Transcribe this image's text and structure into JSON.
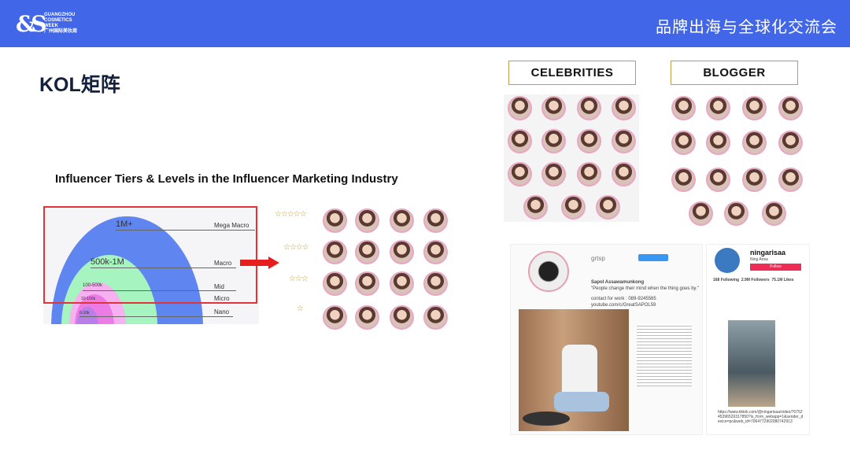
{
  "header": {
    "logo_lines": [
      "GUANGZHOU",
      "COSMETICS",
      "WEEK",
      "广州国际美妆周"
    ],
    "event_title": "品牌出海与全球化交流会",
    "color": "#4166e8"
  },
  "page_title": "KOL矩阵",
  "diagram": {
    "title": "Influencer Tiers & Levels in the Influencer Marketing Industry",
    "tiers": [
      {
        "range": "1M+",
        "name": "Mega Macro",
        "stars": "☆☆☆☆☆"
      },
      {
        "range": "500k-1M",
        "name": "Macro",
        "stars": "☆☆☆☆"
      },
      {
        "range": "100-500k",
        "name": "Mid",
        "stars": "☆☆☆"
      },
      {
        "range": "10-100k",
        "name": "Micro",
        "stars": "☆"
      },
      {
        "range": "0-10k",
        "name": "Nano"
      }
    ]
  },
  "categories": {
    "celebrities": "CELEBRITIES",
    "blogger": "BLOGGER"
  },
  "instagram": {
    "username": "grtsp",
    "bio_name": "Sapol Assawamunkong",
    "quote": "\"People change their mind when the thing goes by.\"",
    "contact": "contact for work : 089-9245565",
    "link": "youtube.com/c/GreatSAPOL59"
  },
  "tiktok": {
    "username": "ningarisaa",
    "display_name": "Ning Arisa",
    "follow_label": "Follow",
    "following": "168",
    "followers": "2.9M",
    "likes": "75.1M",
    "url": "https://www.tiktok.com/@ningarisaa/video/7075245396526317850?is_from_webapp=1&sender_device=pc&web_id=7064772902080742913"
  }
}
